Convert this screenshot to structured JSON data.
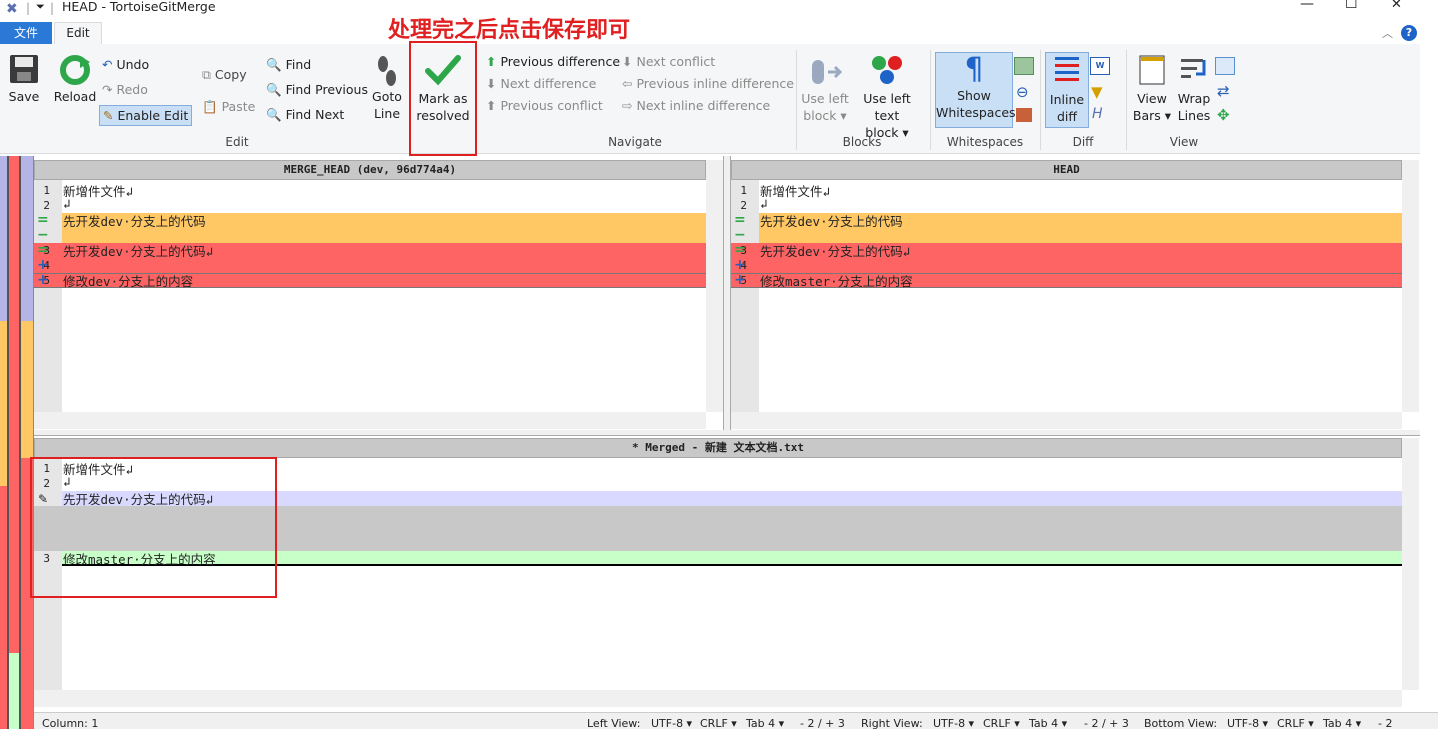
{
  "window": {
    "title": "HEAD - TortoiseGitMerge",
    "min": "—",
    "max": "☐",
    "close": "✕"
  },
  "tabs": {
    "file": "文件",
    "edit": "Edit"
  },
  "annotation": "处理完之后点击保存即可",
  "ribbon": {
    "save": "Save",
    "reload": "Reload",
    "undo": "Undo",
    "redo": "Redo",
    "enable_edit": "Enable Edit",
    "copy": "Copy",
    "paste": "Paste",
    "find": "Find",
    "find_previous": "Find Previous",
    "find_next": "Find Next",
    "goto1": "Goto",
    "goto2": "Line",
    "mark1": "Mark as",
    "mark2": "resolved",
    "prev_diff": "Previous difference",
    "next_diff": "Next difference",
    "prev_conflict": "Previous conflict",
    "next_conflict": "Next conflict",
    "prev_inline": "Previous inline difference",
    "next_inline": "Next inline difference",
    "use_left1": "Use left",
    "use_left2": "block ▾",
    "use_left_text1": "Use left text",
    "use_left_text2": "block ▾",
    "show_ws1": "Show",
    "show_ws2": "Whitespaces",
    "inline1": "Inline",
    "inline2": "diff",
    "viewbars1": "View",
    "viewbars2": "Bars ▾",
    "wrap1": "Wrap",
    "wrap2": "Lines",
    "groups": {
      "edit": "Edit",
      "navigate": "Navigate",
      "blocks": "Blocks",
      "whitespaces": "Whitespaces",
      "diff": "Diff",
      "view": "View"
    }
  },
  "left_pane": {
    "header": "MERGE_HEAD (dev, 96d774a4)",
    "lines": [
      {
        "n": "1",
        "m": "",
        "t": "新增件文件↲"
      },
      {
        "n": "2",
        "m": "",
        "t": "↲"
      },
      {
        "n": "",
        "m": "=",
        "t": "先开发dev·分支上的代码"
      },
      {
        "n": "",
        "m": "−",
        "t": ""
      },
      {
        "n": "3",
        "m": "=",
        "t": "先开发dev·分支上的代码↲"
      },
      {
        "n": "4",
        "m": "+",
        "t": ""
      },
      {
        "n": "5",
        "m": "+",
        "t": "修改dev·分支上的内容"
      }
    ]
  },
  "right_pane": {
    "header": "HEAD",
    "lines": [
      {
        "n": "1",
        "m": "",
        "t": "新增件文件↲"
      },
      {
        "n": "2",
        "m": "",
        "t": "↲"
      },
      {
        "n": "",
        "m": "=",
        "t": "先开发dev·分支上的代码"
      },
      {
        "n": "",
        "m": "−",
        "t": ""
      },
      {
        "n": "3",
        "m": "=",
        "t": "先开发dev·分支上的代码↲"
      },
      {
        "n": "4",
        "m": "+",
        "t": ""
      },
      {
        "n": "5",
        "m": "+",
        "t": "修改master·分支上的内容"
      }
    ]
  },
  "merged_pane": {
    "header": "* Merged - 新建 文本文档.txt",
    "lines": [
      {
        "n": "1",
        "t": "新增件文件↲"
      },
      {
        "n": "2",
        "t": "↲"
      },
      {
        "n": "",
        "t": "先开发dev·分支上的代码↲"
      },
      {
        "n": "3",
        "t": "修改master·分支上的内容"
      }
    ]
  },
  "statusbar": {
    "column": "Column: 1",
    "left_view": "Left View:",
    "right_view": "Right View:",
    "bottom_view": "Bottom View:",
    "enc": "UTF-8 ▾",
    "eol": "CRLF ▾",
    "tab": "Tab 4 ▾",
    "left_counts": "- 2 / + 3",
    "right_counts": "- 2 / + 3",
    "bottom_counts": "- 2"
  },
  "colors": {
    "conflict_orange": "#ffc864",
    "conflict_red": "#ff6464",
    "merged_blue": "#d9d9ff",
    "merged_green": "#c8ffc8",
    "gray_block": "#c8c8c8",
    "annot_red": "#e02020"
  }
}
